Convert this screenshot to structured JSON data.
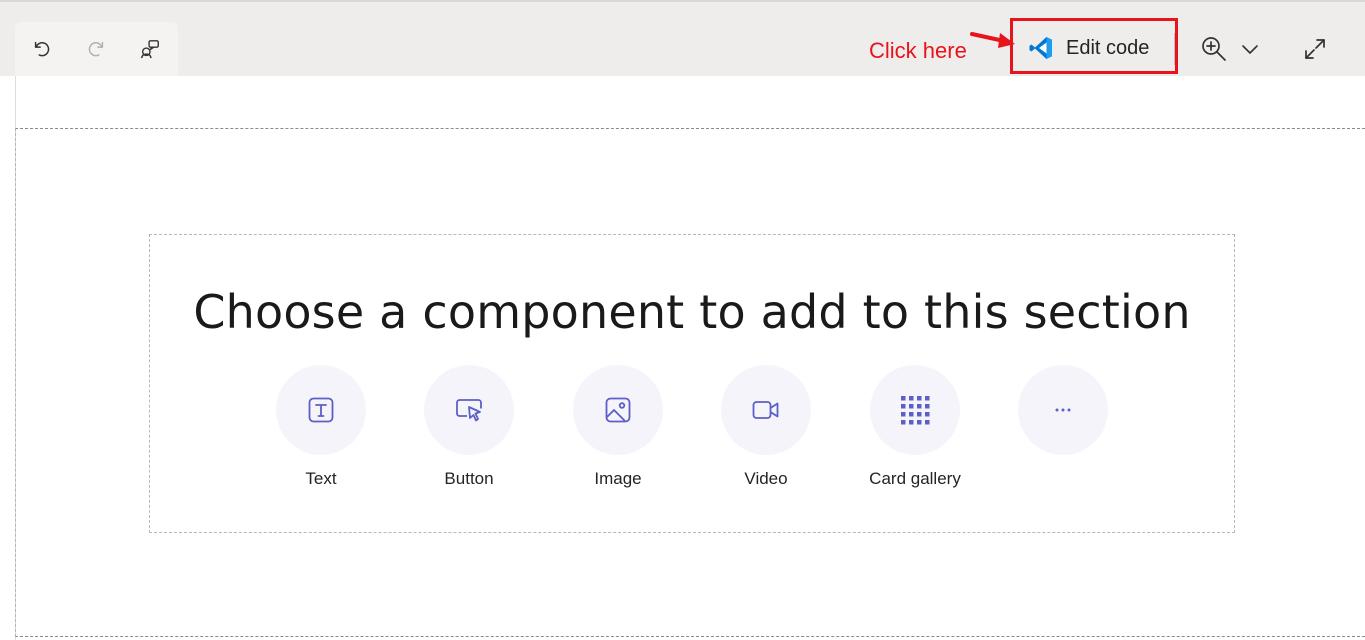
{
  "toolbar": {
    "undo_icon": "undo-icon",
    "redo_icon": "redo-icon",
    "comments_icon": "comments-icon",
    "callout_text": "Click here",
    "edit_code_label": "Edit code",
    "edit_code_icon": "vscode-icon",
    "zoom_icon": "zoom-in-icon",
    "expand_icon": "expand-icon"
  },
  "section": {
    "heading": "Choose a component to add to this section",
    "components": [
      {
        "label": "Text",
        "icon": "text-icon"
      },
      {
        "label": "Button",
        "icon": "button-icon"
      },
      {
        "label": "Image",
        "icon": "image-icon"
      },
      {
        "label": "Video",
        "icon": "video-icon"
      },
      {
        "label": "Card gallery",
        "icon": "card-gallery-icon"
      },
      {
        "label": "",
        "icon": "more-icon"
      }
    ]
  },
  "colors": {
    "accent": "#5b5fc7",
    "callout": "#e8141b",
    "vscode_blue": "#0078d4",
    "toolbar_bg": "#efedeb"
  }
}
